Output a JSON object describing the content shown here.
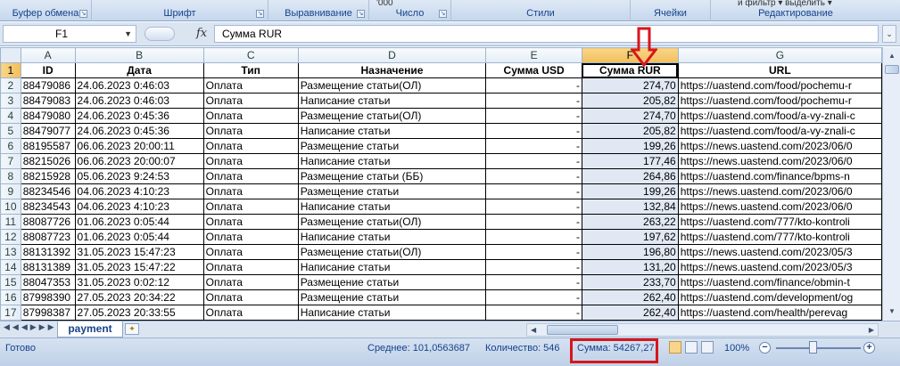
{
  "ribbon": {
    "groups": [
      {
        "label": "Буфер обмена"
      },
      {
        "label": "Шрифт"
      },
      {
        "label": "Выравнивание"
      },
      {
        "label": "Число",
        "top_text": "'000"
      },
      {
        "label": "Стили"
      },
      {
        "label": "Ячейки"
      },
      {
        "label": "Редактирование",
        "top_text": "и фильтр ▾  выделить ▾"
      }
    ]
  },
  "formula_bar": {
    "name_box": "F1",
    "fx": "fx",
    "formula": "Сумма RUR"
  },
  "columns": [
    "A",
    "B",
    "C",
    "D",
    "E",
    "F",
    "G"
  ],
  "selected_column": "F",
  "header_row": [
    "ID",
    "Дата",
    "Тип",
    "Назначение",
    "Сумма USD",
    "Сумма RUR",
    "URL"
  ],
  "rows": [
    {
      "n": "2",
      "cells": [
        "88479086",
        "24.06.2023 0:46:03",
        "Оплата",
        "Размещение статьи(ОЛ)",
        "-",
        "274,70",
        "https://uastend.com/food/pochemu-r"
      ]
    },
    {
      "n": "3",
      "cells": [
        "88479083",
        "24.06.2023 0:46:03",
        "Оплата",
        "Написание статьи",
        "-",
        "205,82",
        "https://uastend.com/food/pochemu-r"
      ]
    },
    {
      "n": "4",
      "cells": [
        "88479080",
        "24.06.2023 0:45:36",
        "Оплата",
        "Размещение статьи(ОЛ)",
        "-",
        "274,70",
        "https://uastend.com/food/a-vy-znali-c"
      ]
    },
    {
      "n": "5",
      "cells": [
        "88479077",
        "24.06.2023 0:45:36",
        "Оплата",
        "Написание статьи",
        "-",
        "205,82",
        "https://uastend.com/food/a-vy-znali-c"
      ]
    },
    {
      "n": "6",
      "cells": [
        "88195587",
        "06.06.2023 20:00:11",
        "Оплата",
        "Размещение статьи",
        "-",
        "199,26",
        "https://news.uastend.com/2023/06/0"
      ]
    },
    {
      "n": "7",
      "cells": [
        "88215026",
        "06.06.2023 20:00:07",
        "Оплата",
        "Написание статьи",
        "-",
        "177,46",
        "https://news.uastend.com/2023/06/0"
      ]
    },
    {
      "n": "8",
      "cells": [
        "88215928",
        "05.06.2023 9:24:53",
        "Оплата",
        "Размещение статьи (ББ)",
        "-",
        "264,86",
        "https://uastend.com/finance/bpms-n"
      ]
    },
    {
      "n": "9",
      "cells": [
        "88234546",
        "04.06.2023 4:10:23",
        "Оплата",
        "Размещение статьи",
        "-",
        "199,26",
        "https://news.uastend.com/2023/06/0"
      ]
    },
    {
      "n": "10",
      "cells": [
        "88234543",
        "04.06.2023 4:10:23",
        "Оплата",
        "Написание статьи",
        "-",
        "132,84",
        "https://news.uastend.com/2023/06/0"
      ]
    },
    {
      "n": "11",
      "cells": [
        "88087726",
        "01.06.2023 0:05:44",
        "Оплата",
        "Размещение статьи(ОЛ)",
        "-",
        "263,22",
        "https://uastend.com/777/kto-kontroli"
      ]
    },
    {
      "n": "12",
      "cells": [
        "88087723",
        "01.06.2023 0:05:44",
        "Оплата",
        "Написание статьи",
        "-",
        "197,62",
        "https://uastend.com/777/kto-kontroli"
      ]
    },
    {
      "n": "13",
      "cells": [
        "88131392",
        "31.05.2023 15:47:23",
        "Оплата",
        "Размещение статьи(ОЛ)",
        "-",
        "196,80",
        "https://news.uastend.com/2023/05/3"
      ]
    },
    {
      "n": "14",
      "cells": [
        "88131389",
        "31.05.2023 15:47:22",
        "Оплата",
        "Написание статьи",
        "-",
        "131,20",
        "https://news.uastend.com/2023/05/3"
      ]
    },
    {
      "n": "15",
      "cells": [
        "88047353",
        "31.05.2023 0:02:12",
        "Оплата",
        "Размещение статьи",
        "-",
        "233,70",
        "https://uastend.com/finance/obmin-t"
      ]
    },
    {
      "n": "16",
      "cells": [
        "87998390",
        "27.05.2023 20:34:22",
        "Оплата",
        "Размещение статьи",
        "-",
        "262,40",
        "https://uastend.com/development/og"
      ]
    },
    {
      "n": "17",
      "cells": [
        "87998387",
        "27.05.2023 20:33:55",
        "Оплата",
        "Написание статьи",
        "-",
        "262,40",
        "https://uastend.com/health/perevag"
      ]
    }
  ],
  "sheet_tab": "payment",
  "status": {
    "ready": "Готово",
    "average": "Среднее: 101,0563687",
    "count": "Количество: 546",
    "sum": "Сумма: 54267,27",
    "zoom": "100%"
  },
  "colors": {
    "annotation_red": "#d7161c",
    "selection_header": "#f1bf5a",
    "ribbon_text": "#15428b"
  }
}
